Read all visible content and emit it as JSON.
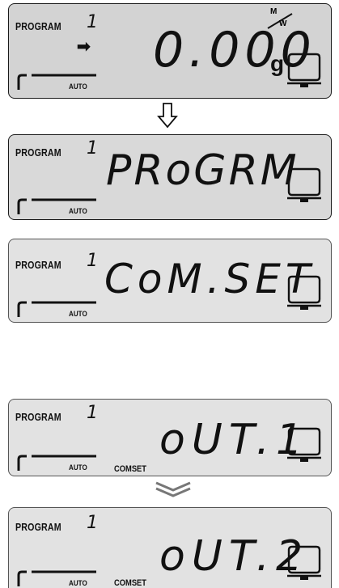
{
  "panels": [
    {
      "program_label": "PROGRAM",
      "program_number": "1",
      "auto_label": "AUTO",
      "main_text": "0.000",
      "unit": "g",
      "mode_top": "M",
      "mode_bottom": "W"
    },
    {
      "program_label": "PROGRAM",
      "program_number": "1",
      "auto_label": "AUTO",
      "main_text": "PRoGRM"
    },
    {
      "program_label": "PROGRAM",
      "program_number": "1",
      "auto_label": "AUTO",
      "main_text": "CoM.SET"
    },
    {
      "program_label": "PROGRAM",
      "program_number": "1",
      "auto_label": "AUTO",
      "main_text": "oUT.1",
      "sub_label": "COMSET"
    },
    {
      "program_label": "PROGRAM",
      "program_number": "1",
      "auto_label": "AUTO",
      "main_text": "oUT.2",
      "sub_label": "COMSET"
    }
  ],
  "icons": {
    "arrow": "right-arrow-icon",
    "step_arrow": "down-arrow-icon",
    "cycle_arrow": "chevron-down-icon",
    "pan": "weighing-pan-icon"
  },
  "colors": {
    "lcd_background": "#d3d3d3",
    "segment": "#111111",
    "border": "#1a1a1a"
  }
}
